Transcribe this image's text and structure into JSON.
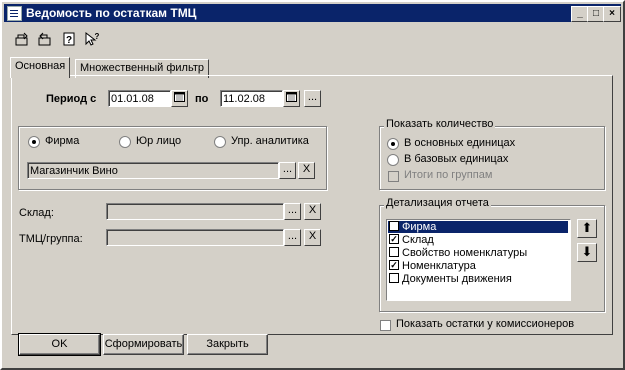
{
  "window": {
    "title": "Ведомость по остаткам ТМЦ",
    "min_label": "_",
    "max_label": "□",
    "close_label": "×"
  },
  "toolbar": {
    "icons": [
      "save-settings-icon",
      "restore-settings-icon",
      "help-icon",
      "context-help-icon"
    ]
  },
  "tabs": [
    {
      "label": "Основная",
      "active": true
    },
    {
      "label": "Множественный фильтр",
      "active": false
    }
  ],
  "period": {
    "label": "Период с",
    "from": "01.01.08",
    "to_label": "по",
    "to": "11.02.08",
    "more_label": "..."
  },
  "entity": {
    "options": [
      "Фирма",
      "Юр лицо",
      "Упр. аналитика"
    ],
    "selected": "Фирма",
    "value": "Магазинчик Вино"
  },
  "warehouse": {
    "label": "Склад:",
    "value": ""
  },
  "goods": {
    "label": "ТМЦ/группа:",
    "value": ""
  },
  "quantity": {
    "title": "Показать количество",
    "options": [
      "В основных единицах",
      "В базовых единицах"
    ],
    "selected": "В основных единицах",
    "group_totals_label": "Итоги по группам",
    "group_totals_checked": false
  },
  "detail": {
    "title": "Детализация отчета",
    "items": [
      {
        "label": "Фирма",
        "checked": false,
        "selected": true
      },
      {
        "label": "Склад",
        "checked": true,
        "selected": false
      },
      {
        "label": "Свойство номенклатуры",
        "checked": false,
        "selected": false
      },
      {
        "label": "Номенклатура",
        "checked": true,
        "selected": false
      },
      {
        "label": "Документы движения",
        "checked": false,
        "selected": false
      }
    ],
    "up_label": "⬆",
    "down_label": "⬇"
  },
  "commission": {
    "label": "Показать остатки у комиссионеров",
    "checked": false
  },
  "buttons": {
    "ok": "OK",
    "generate": "Сформировать",
    "close": "Закрыть"
  },
  "glyphs": {
    "ellipsis": "...",
    "clear": "X",
    "check": "✓"
  }
}
